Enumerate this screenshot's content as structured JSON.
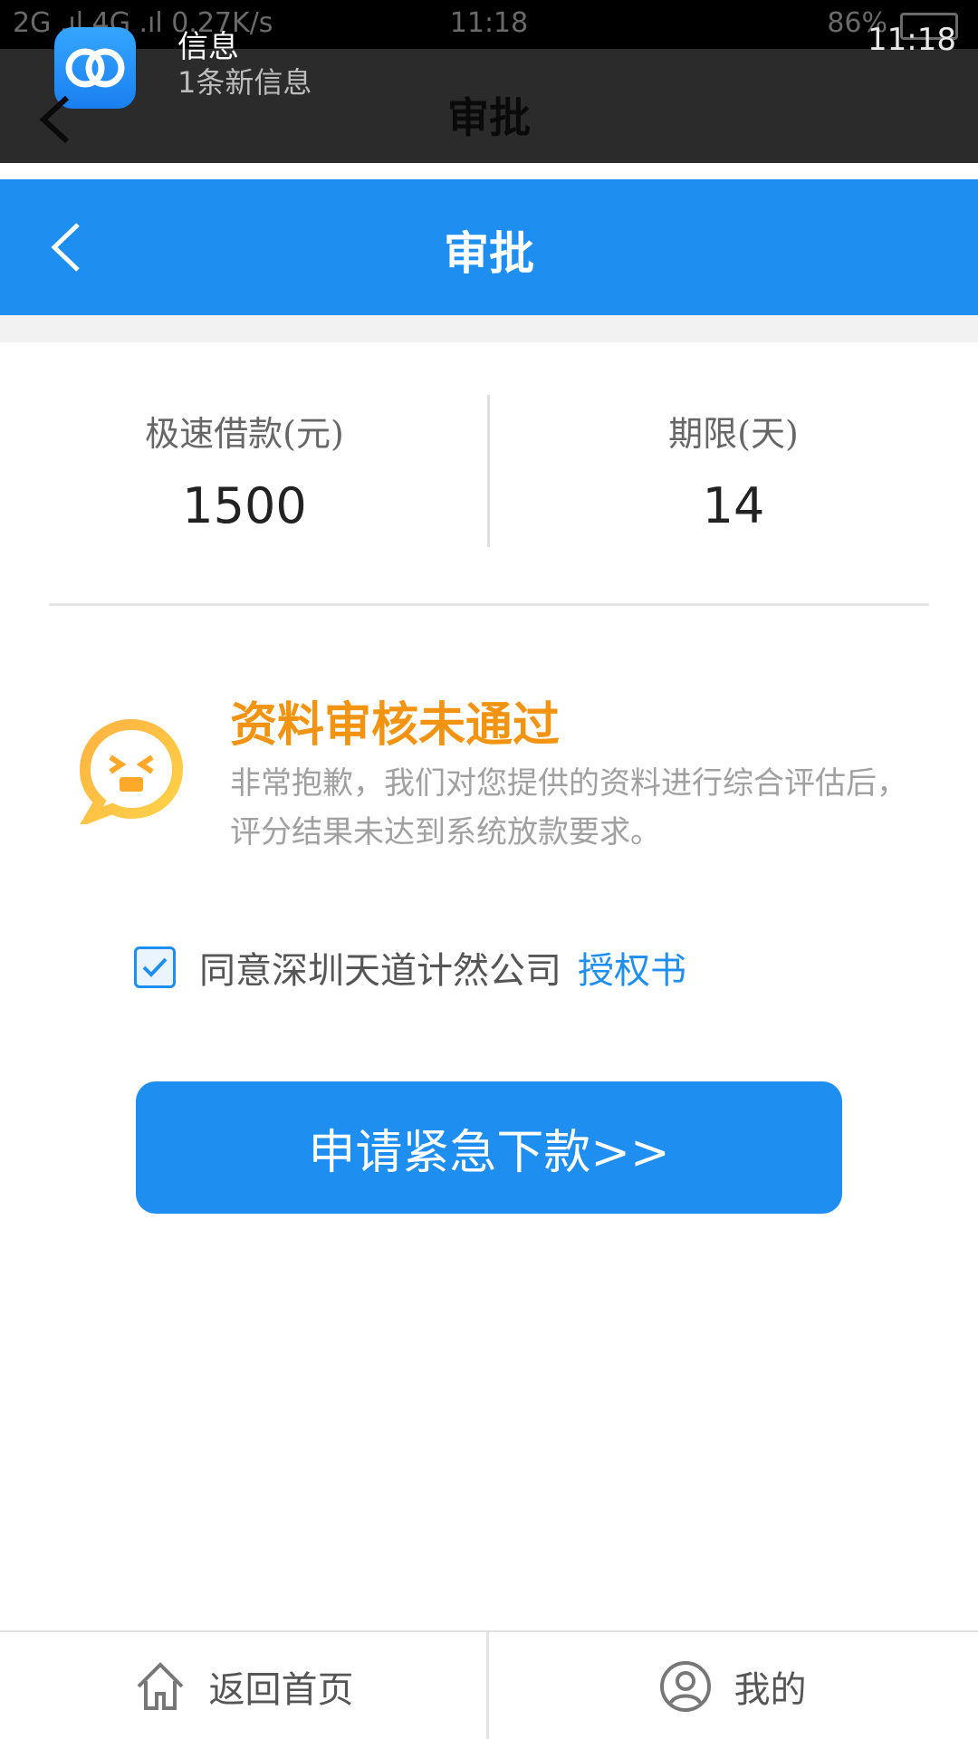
{
  "status_bar": {
    "network_text": "2G .ıl 4G .ıl 0.27K/s",
    "center_time": "11:18",
    "battery_text": "86%"
  },
  "notification": {
    "app_title": "信息",
    "subtitle": "1条新信息",
    "time": "11:18",
    "underlying_title": "审批"
  },
  "header": {
    "title": "审批"
  },
  "loan": {
    "amount_label": "极速借款(元)",
    "amount_value": "1500",
    "term_label": "期限(天)",
    "term_value": "14"
  },
  "result": {
    "title": "资料审核未通过",
    "description": "非常抱歉，我们对您提供的资料进行综合评估后，评分结果未达到系统放款要求。",
    "icon": "sad-face-chat-icon"
  },
  "agreement": {
    "checked": true,
    "text": "同意深圳天道计然公司",
    "link_text": "授权书"
  },
  "apply_button": {
    "label": "申请紧急下款>>"
  },
  "bottom_nav": {
    "home_label": "返回首页",
    "home_icon": "house-icon",
    "me_label": "我的",
    "me_icon": "user-icon"
  },
  "colors": {
    "primary": "#1f8ef1",
    "warning": "#f29411",
    "text_muted": "#a0a0a0"
  }
}
